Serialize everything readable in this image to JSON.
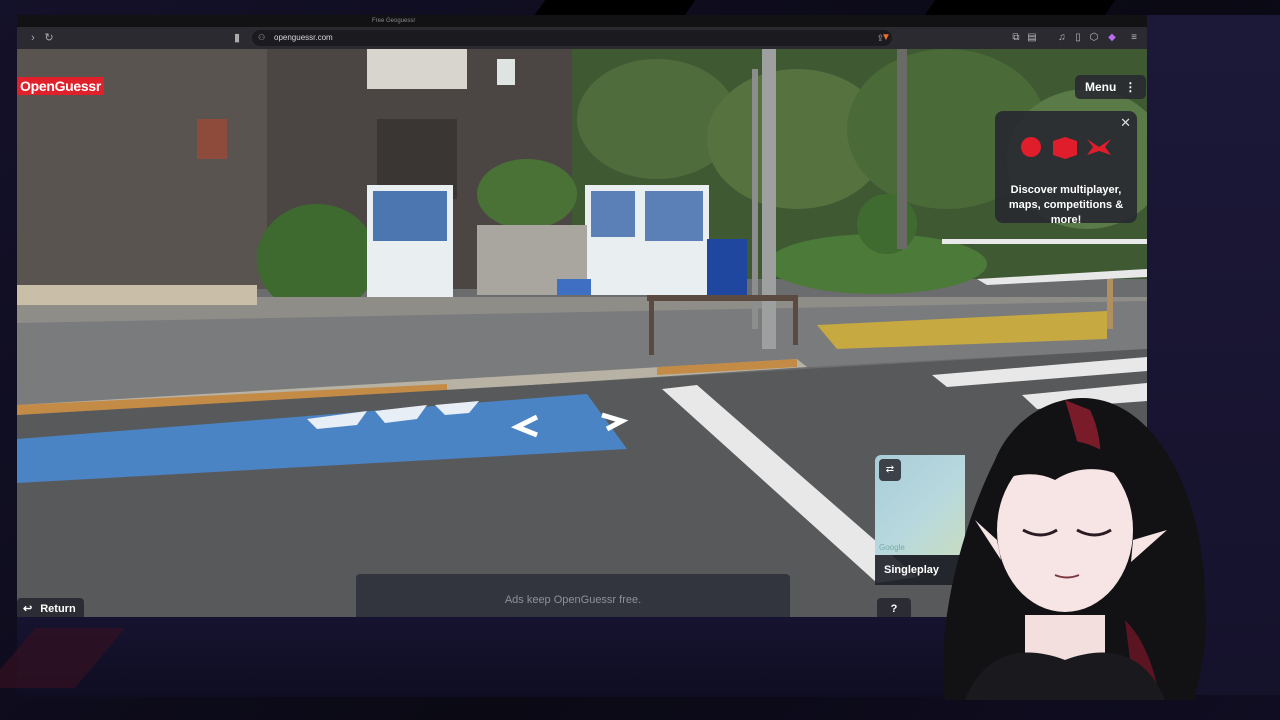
{
  "browser": {
    "url": "openguessr.com",
    "tab_title": "Free Geoguessr"
  },
  "game": {
    "logo": "OpenGuessr",
    "menu_label": "Menu",
    "promo": {
      "text": "Discover multiplayer, maps, competitions & more!"
    },
    "return_label": "Return",
    "ad_text": "Ads keep OpenGuessr free.",
    "mode_label": "Singleplay",
    "help_label": "?",
    "map_credit": "Google"
  },
  "colors": {
    "brand_red": "#e0202a",
    "panel_dark": "#282830",
    "road_blue": "#4a84c4"
  }
}
